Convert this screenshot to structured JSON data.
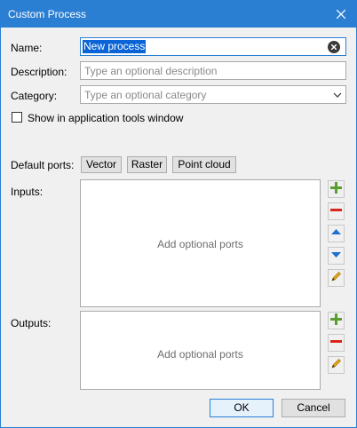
{
  "window": {
    "title": "Custom Process"
  },
  "form": {
    "name_label": "Name:",
    "name_value": "New process",
    "description_label": "Description:",
    "description_placeholder": "Type an optional description",
    "category_label": "Category:",
    "category_placeholder": "Type an optional category",
    "show_tools_label": "Show in application tools window",
    "show_tools_checked": false
  },
  "ports": {
    "default_label": "Default ports:",
    "buttons": [
      "Vector",
      "Raster",
      "Point cloud"
    ],
    "inputs_label": "Inputs:",
    "inputs_placeholder": "Add optional ports",
    "outputs_label": "Outputs:",
    "outputs_placeholder": "Add optional ports"
  },
  "footer": {
    "ok_label": "OK",
    "cancel_label": "Cancel"
  },
  "icons": {
    "add": "plus-icon",
    "remove": "minus-icon",
    "up": "arrow-up-icon",
    "down": "arrow-down-icon",
    "edit": "pencil-icon",
    "close": "close-icon",
    "clear": "clear-icon",
    "dropdown": "chevron-down-icon"
  },
  "colors": {
    "titlebar": "#2b7fd3",
    "add": "#5a9e2f",
    "remove": "#d9261c",
    "arrow": "#1e6fd0",
    "edit": "#e8a317"
  }
}
